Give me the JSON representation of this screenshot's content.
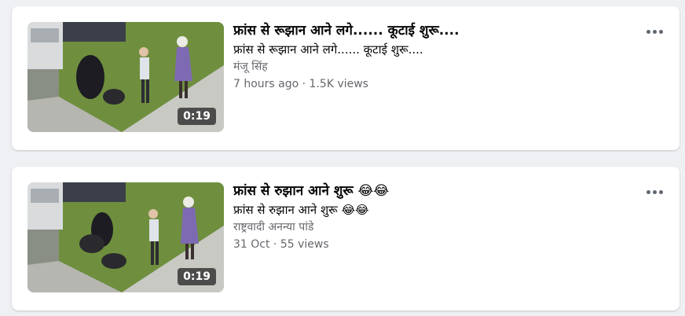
{
  "videos": [
    {
      "title": "फ्रांस से रूझान आने लगे...... कूटाई शुरू....",
      "description": "फ्रांस से रूझान आने लगे...... कूटाई शुरू....",
      "author": "मंजू सिंह",
      "meta": "7 hours ago · 1.5K views",
      "duration": "0:19",
      "thumbnail_icon": "video-thumbnail",
      "options_icon": "more-options-icon"
    },
    {
      "title": "फ्रांस से रुझान आने शुरू 😂😂",
      "description": "फ्रांस से रुझान आने शुरू 😂😂",
      "author": "राष्ट्रवादी अनन्या पांडे",
      "meta": "31 Oct · 55 views",
      "duration": "0:19",
      "thumbnail_icon": "video-thumbnail",
      "options_icon": "more-options-icon"
    }
  ],
  "colors": {
    "page_background": "#eef0f3",
    "card_background": "#ffffff",
    "title_text": "#050505",
    "secondary_text": "#65676b"
  }
}
